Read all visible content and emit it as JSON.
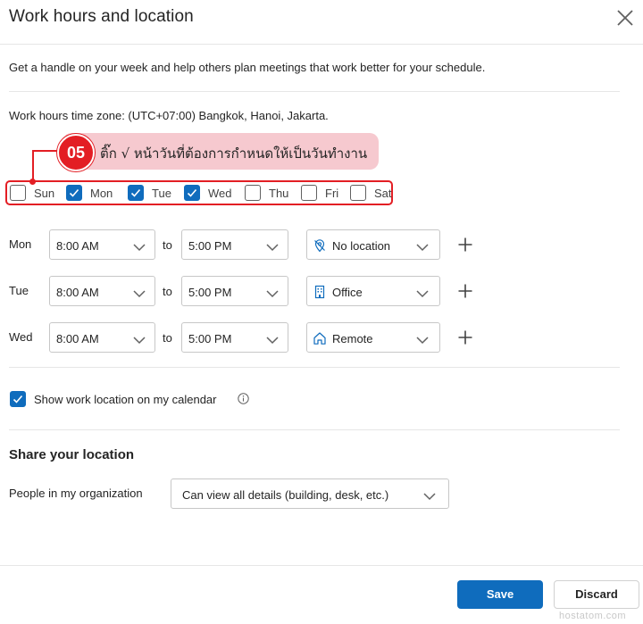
{
  "dialog": {
    "title": "Work hours and location",
    "intro": "Get a handle on your week and help others plan meetings that work better for your schedule.",
    "timezone": "Work hours time zone: (UTC+07:00) Bangkok, Hanoi, Jakarta."
  },
  "annotation": {
    "step": "05",
    "text": "ติ๊ก √ หน้าวันที่ต้องการกำหนดให้เป็นวันทำงาน",
    "color": "#e31e24",
    "pill_color": "#f6c9cf"
  },
  "days": [
    {
      "label": "Sun",
      "checked": false
    },
    {
      "label": "Mon",
      "checked": true
    },
    {
      "label": "Tue",
      "checked": true
    },
    {
      "label": "Wed",
      "checked": true
    },
    {
      "label": "Thu",
      "checked": false
    },
    {
      "label": "Fri",
      "checked": false
    },
    {
      "label": "Sat",
      "checked": false
    }
  ],
  "schedule": [
    {
      "day": "Mon",
      "start": "8:00 AM",
      "to": "to",
      "end": "5:00 PM",
      "location": "No location",
      "location_icon": "no-location-icon"
    },
    {
      "day": "Tue",
      "start": "8:00 AM",
      "to": "to",
      "end": "5:00 PM",
      "location": "Office",
      "location_icon": "office-building-icon"
    },
    {
      "day": "Wed",
      "start": "8:00 AM",
      "to": "to",
      "end": "5:00 PM",
      "location": "Remote",
      "location_icon": "home-icon"
    }
  ],
  "show_location": {
    "label": "Show work location on my calendar",
    "checked": true,
    "info_icon": "info-icon"
  },
  "share": {
    "title": "Share your location",
    "people_label": "People in my organization",
    "people_value": "Can view all details (building, desk, etc.)"
  },
  "buttons": {
    "save": "Save",
    "discard": "Discard"
  },
  "watermark": "hostatom.com",
  "colors": {
    "accent": "#0f6cbd",
    "annotation": "#e31e24"
  }
}
